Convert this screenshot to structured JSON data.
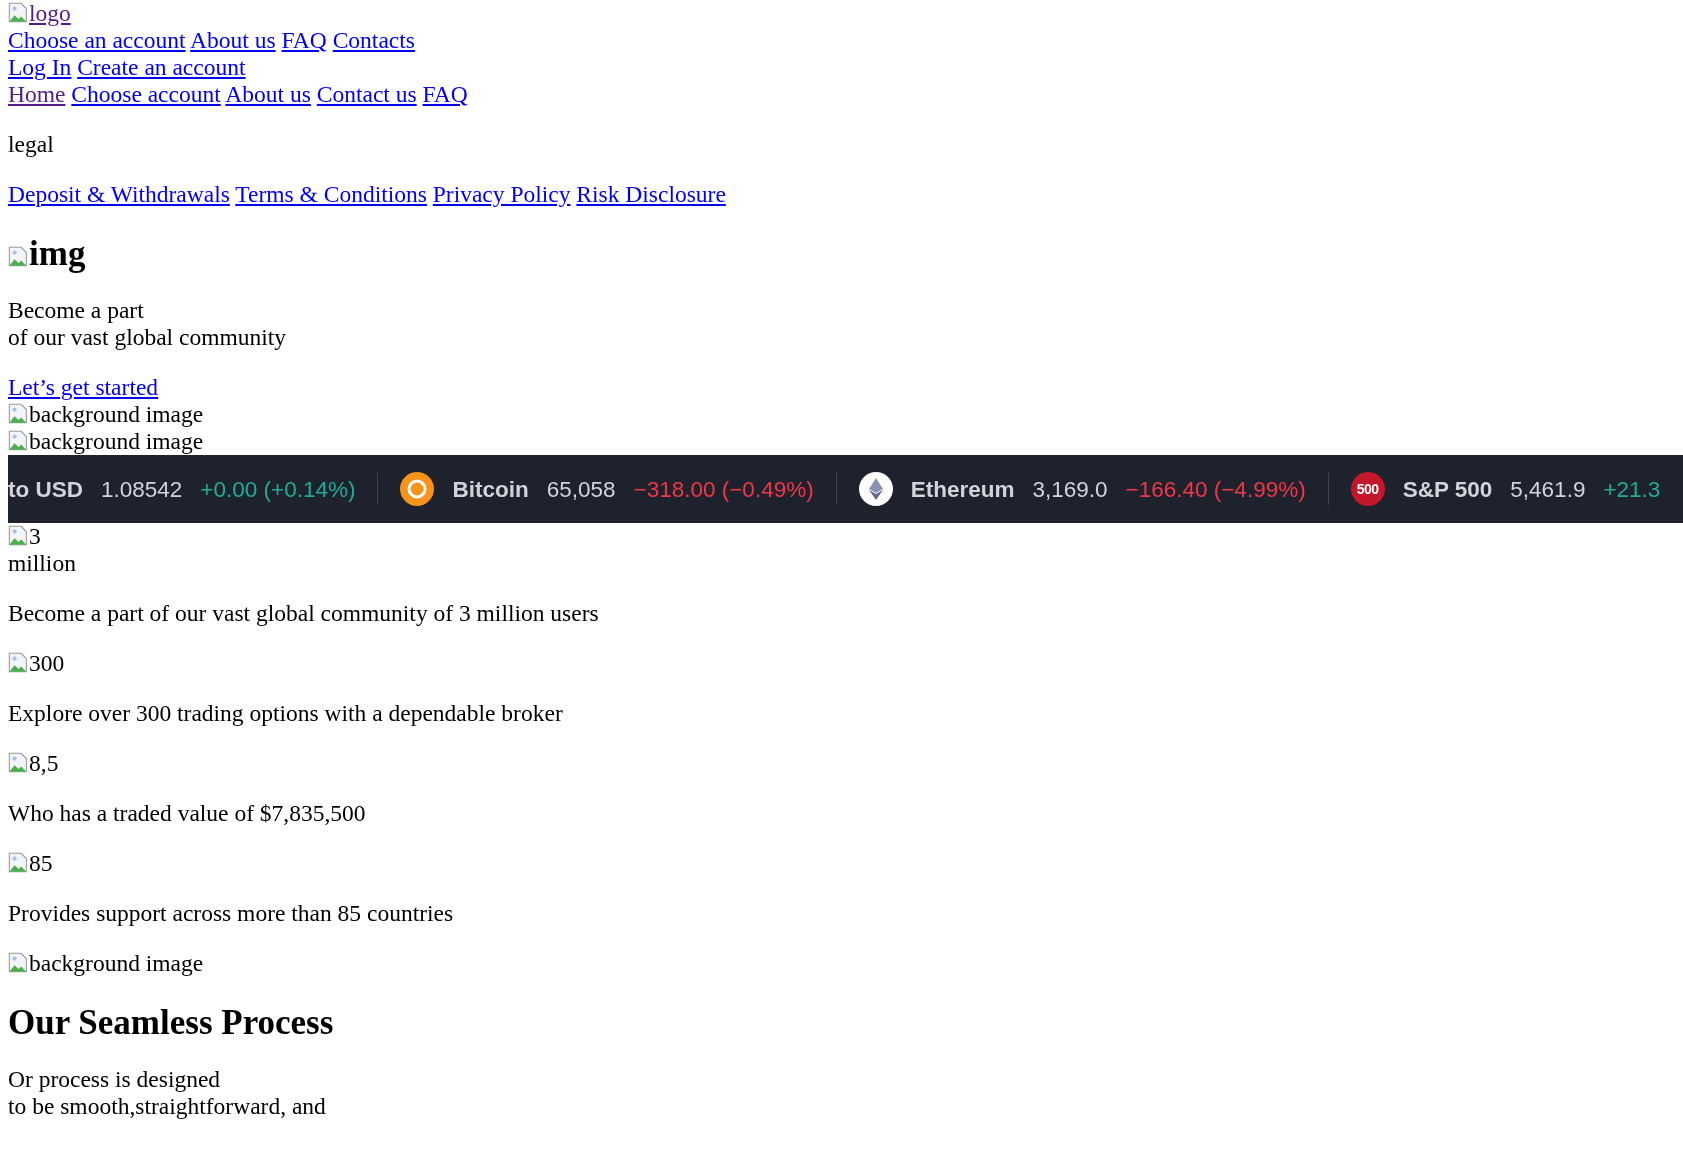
{
  "header": {
    "logo": {
      "alt": "logo",
      "visited": true
    },
    "nav": [
      {
        "label": "Choose an account",
        "visited": false
      },
      {
        "label": "About us",
        "visited": false
      },
      {
        "label": "FAQ",
        "visited": false
      },
      {
        "label": "Contacts",
        "visited": false
      }
    ],
    "auth": [
      {
        "label": "Log In",
        "visited": false
      },
      {
        "label": "Create an account",
        "visited": false
      }
    ]
  },
  "menu": [
    {
      "label": "Home",
      "visited": true
    },
    {
      "label": "Choose account",
      "visited": false
    },
    {
      "label": "About us",
      "visited": false
    },
    {
      "label": "Contact us",
      "visited": false
    },
    {
      "label": "FAQ",
      "visited": false
    }
  ],
  "legal": {
    "title": "legal",
    "links": [
      {
        "label": "Deposit & Withdrawals",
        "visited": false
      },
      {
        "label": "Terms & Conditions",
        "visited": false
      },
      {
        "label": "Privacy Policy",
        "visited": false
      },
      {
        "label": "Risk Disclosure",
        "visited": false
      }
    ]
  },
  "hero": {
    "image_alt": "img",
    "lines": [
      "Become a part",
      "of our vast global community"
    ],
    "cta": "Let’s get started",
    "background_alts": [
      "background image",
      "background image"
    ]
  },
  "ticker": [
    {
      "kind": "plain",
      "name": "to USD",
      "price": "1.08542",
      "change": "+0.00 (+0.14%)",
      "color": "#22ab94"
    },
    {
      "kind": "coin",
      "name": "Bitcoin",
      "price": "65,058",
      "change": "−318.00 (−0.49%)",
      "color": "#f23645"
    },
    {
      "kind": "diamond",
      "name": "Ethereum",
      "price": "3,169.0",
      "change": "−166.40 (−4.99%)",
      "color": "#f23645"
    },
    {
      "kind": "badge",
      "icon_text": "500",
      "name": "S&P 500",
      "price": "5,461.9",
      "change": "+21.3",
      "color": "#22ab94"
    }
  ],
  "stats": [
    {
      "image_alt": "3",
      "suffix": "million",
      "text": "Become a part of our vast global community of 3 million users"
    },
    {
      "image_alt": "300",
      "text": "Explore over 300 trading options with a dependable broker"
    },
    {
      "image_alt": "8,5",
      "text": "Who has a traded value of $7,835,500"
    },
    {
      "image_alt": "85",
      "text": "Provides support across more than 85 countries"
    }
  ],
  "background_alt": "background image",
  "process": {
    "title": "Our Seamless Process",
    "lines": [
      "Or process is designed",
      "to be smooth,straightforward, and"
    ]
  }
}
